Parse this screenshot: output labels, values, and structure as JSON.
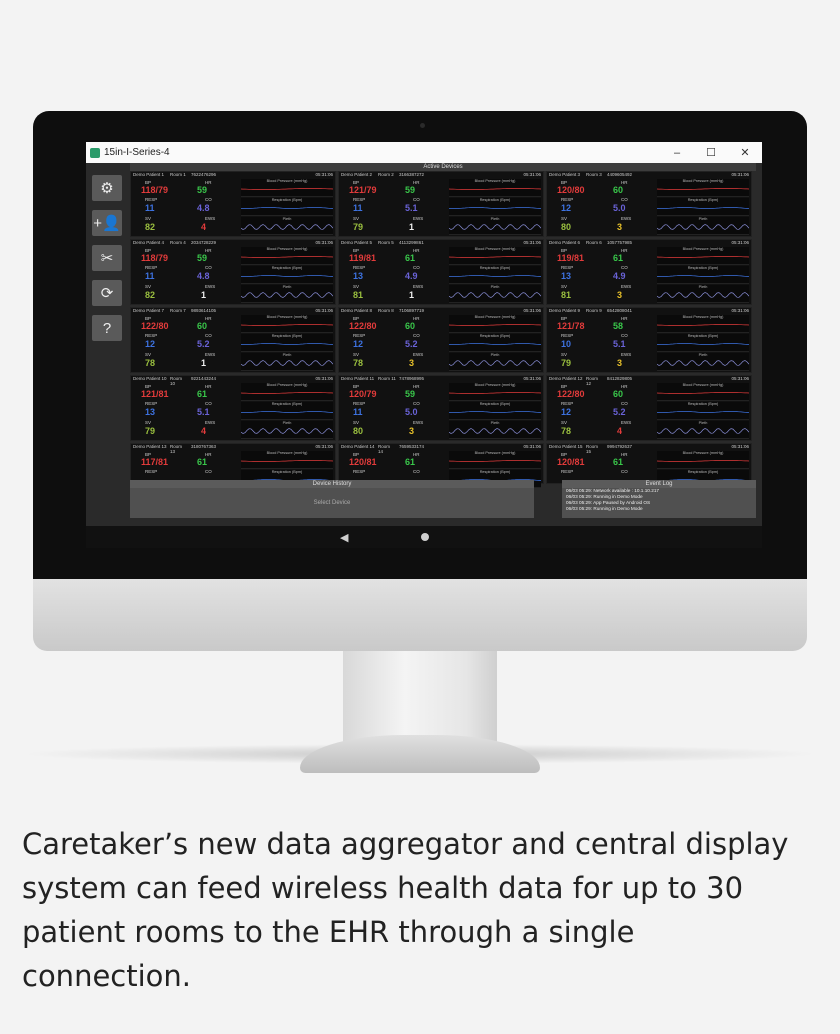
{
  "window": {
    "title": "15in-I-Series-4",
    "min": "–",
    "max": "☐",
    "close": "✕"
  },
  "sidebar": [
    {
      "name": "settings-button",
      "glyph": "⚙"
    },
    {
      "name": "add-user-button",
      "glyph": "+👤"
    },
    {
      "name": "disconnect-button",
      "glyph": "✂"
    },
    {
      "name": "refresh-button",
      "glyph": "⟳"
    },
    {
      "name": "help-button",
      "glyph": "?"
    }
  ],
  "grid_title": "Active Devices",
  "labels": {
    "bp": "BP",
    "hr": "HR",
    "resp": "RESP",
    "co": "CO",
    "sv": "SV",
    "ews": "EWS",
    "g_bp": "Blood Pressure (mmHg)",
    "g_resp": "Respiration (Bpm)",
    "g_pleth": "Pleth"
  },
  "patients": [
    {
      "name": "Demo Patient 1",
      "room": "Room 1",
      "id": "7622476296",
      "time": "05:31:06",
      "bp": "118/79",
      "hr": "59",
      "resp": "11",
      "co": "4.8",
      "sv": "82",
      "ews": "4"
    },
    {
      "name": "Demo Patient 2",
      "room": "Room 2",
      "id": "3166387272",
      "time": "05:31:06",
      "bp": "121/79",
      "hr": "59",
      "resp": "11",
      "co": "5.1",
      "sv": "79",
      "ews": "1"
    },
    {
      "name": "Demo Patient 3",
      "room": "Room 3",
      "id": "4409605492",
      "time": "05:31:06",
      "bp": "120/80",
      "hr": "60",
      "resp": "12",
      "co": "5.0",
      "sv": "80",
      "ews": "3"
    },
    {
      "name": "Demo Patient 4",
      "room": "Room 4",
      "id": "2034728229",
      "time": "05:31:06",
      "bp": "118/79",
      "hr": "59",
      "resp": "11",
      "co": "4.8",
      "sv": "82",
      "ews": "1"
    },
    {
      "name": "Demo Patient 5",
      "room": "Room 5",
      "id": "4113299861",
      "time": "05:31:06",
      "bp": "119/81",
      "hr": "61",
      "resp": "13",
      "co": "4.9",
      "sv": "81",
      "ews": "1"
    },
    {
      "name": "Demo Patient 6",
      "room": "Room 6",
      "id": "1057757985",
      "time": "05:31:06",
      "bp": "119/81",
      "hr": "61",
      "resp": "13",
      "co": "4.9",
      "sv": "81",
      "ews": "3"
    },
    {
      "name": "Demo Patient 7",
      "room": "Room 7",
      "id": "9893614105",
      "time": "05:31:06",
      "bp": "122/80",
      "hr": "60",
      "resp": "12",
      "co": "5.2",
      "sv": "78",
      "ews": "1"
    },
    {
      "name": "Demo Patient 8",
      "room": "Room 8",
      "id": "7106897719",
      "time": "05:31:06",
      "bp": "122/80",
      "hr": "60",
      "resp": "12",
      "co": "5.2",
      "sv": "78",
      "ews": "3"
    },
    {
      "name": "Demo Patient 9",
      "room": "Room 9",
      "id": "6542808041",
      "time": "05:31:06",
      "bp": "121/78",
      "hr": "58",
      "resp": "10",
      "co": "5.1",
      "sv": "79",
      "ews": "3"
    },
    {
      "name": "Demo Patient 10",
      "room": "Room 10",
      "id": "9221443244",
      "time": "05:31:06",
      "bp": "121/81",
      "hr": "61",
      "resp": "13",
      "co": "5.1",
      "sv": "79",
      "ews": "4"
    },
    {
      "name": "Demo Patient 11",
      "room": "Room 11",
      "id": "7478968995",
      "time": "05:31:06",
      "bp": "120/79",
      "hr": "59",
      "resp": "11",
      "co": "5.0",
      "sv": "80",
      "ews": "3"
    },
    {
      "name": "Demo Patient 12",
      "room": "Room 12",
      "id": "8412829805",
      "time": "05:31:06",
      "bp": "122/80",
      "hr": "60",
      "resp": "12",
      "co": "5.2",
      "sv": "78",
      "ews": "4"
    },
    {
      "name": "Demo Patient 13",
      "room": "Room 13",
      "id": "3180767363",
      "time": "05:31:06",
      "bp": "117/81",
      "hr": "61"
    },
    {
      "name": "Demo Patient 14",
      "room": "Room 14",
      "id": "7659533174",
      "time": "05:31:06",
      "bp": "120/81",
      "hr": "61"
    },
    {
      "name": "Demo Patient 15",
      "room": "Room 15",
      "id": "9994792637",
      "time": "05:31:06",
      "bp": "120/81",
      "hr": "61"
    }
  ],
  "history": {
    "title": "Device History",
    "placeholder": "Select Device"
  },
  "log": {
    "title": "Event Log",
    "lines": [
      "06/03 05:29: Network available : 10.1.10.217",
      "06/03 05:29: Running in Demo Mode",
      "06/03 05:29: App Paused by Android OS",
      "06/03 05:29: Running in Demo Mode"
    ]
  },
  "nav": {
    "back": "◀"
  },
  "caption": "Caretaker’s new data aggregator and central display system can feed wireless health data for up to 30 patient rooms to the EHR through a single connection."
}
